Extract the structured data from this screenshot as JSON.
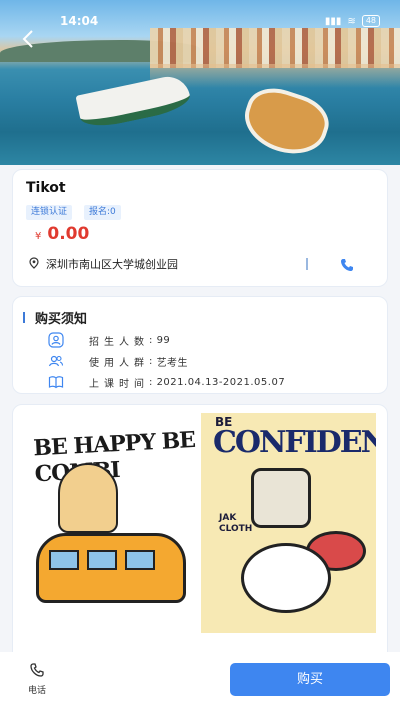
{
  "status_bar": {
    "time": "14:04",
    "battery": "48"
  },
  "store": {
    "name": "Tikot",
    "tags": [
      "连锁认证",
      "报名:0"
    ],
    "price_symbol": "¥",
    "price": "0.00",
    "address": "深圳市南山区大学城创业园"
  },
  "purchase_notice": {
    "title": "购买须知",
    "rows": [
      {
        "label": "招生人数",
        "value": "99",
        "icon": "person-icon"
      },
      {
        "label": "使用人群",
        "value": "艺考生",
        "icon": "group-icon"
      },
      {
        "label": "上课时间",
        "value": "2021.04.13-2021.05.07",
        "icon": "book-icon"
      }
    ]
  },
  "posters": {
    "left_title": "BE HAPPY BE COMBI",
    "right_top": "BE",
    "right_title": "CONFIDENT",
    "right_small": "JAK CLOTH"
  },
  "bottom_bar": {
    "call_label": "电话",
    "buy_label": "购买"
  },
  "colors": {
    "accent": "#3e86f0",
    "price": "#e03a2f",
    "tag_bg": "#e8f1fd"
  }
}
